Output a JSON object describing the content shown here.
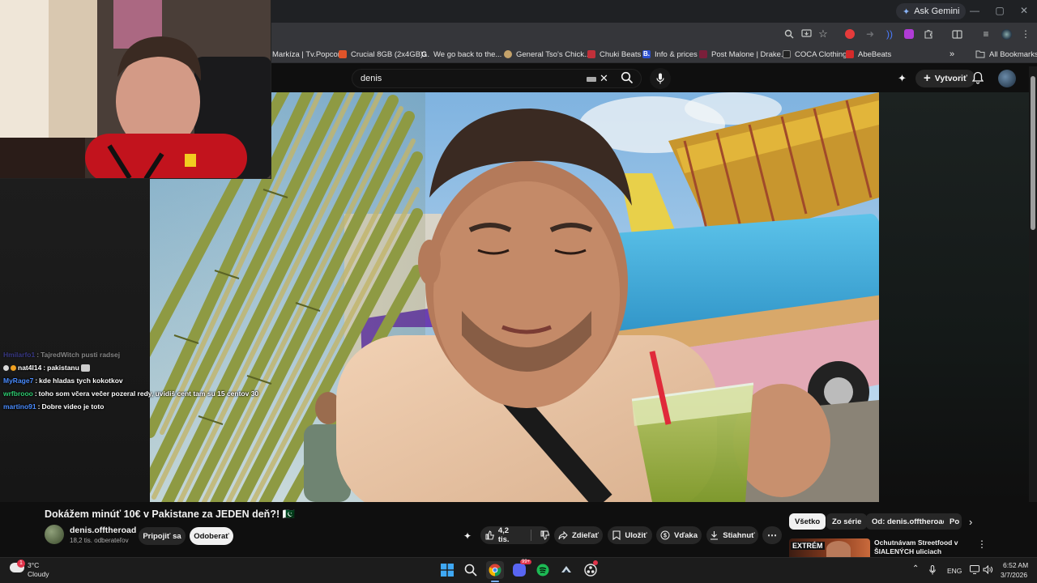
{
  "browser": {
    "gemini_label": "Ask Gemini",
    "bookmarks": [
      {
        "label": "Markíza | Tv.Popcor...",
        "color": "#d9d9d9"
      },
      {
        "label": "Crucial 8GB (2x4GB)...",
        "color": "#e0542a"
      },
      {
        "label": "We go back to the...",
        "color": "#ffffff"
      },
      {
        "label": "General Tso's Chick...",
        "color": "#c4a26a"
      },
      {
        "label": "Chuki Beats",
        "color": "#c0303a"
      },
      {
        "label": "Info & prices",
        "color": "#2a4fd0"
      },
      {
        "label": "Post Malone | Drake...",
        "color": "#7a1f3a"
      },
      {
        "label": "COCA Clothing",
        "color": "#222222"
      },
      {
        "label": "AbeBeats",
        "color": "#d42a2a"
      }
    ],
    "all_bookmarks": "All Bookmarks"
  },
  "youtube": {
    "search_query": "denis",
    "create_label": "Vytvoriť",
    "video_title": "Dokážem minúť 10€ v Pakistane za JEDEN deň?! 🇵🇰",
    "video_flag": "PK",
    "channel_name": "denis.offtheroad",
    "subscribers": "18,2 tis. odberateľov",
    "join_label": "Pripojiť sa",
    "unsubscribe_label": "Odoberať",
    "like_count": "4,2 tis.",
    "share_label": "Zdieľať",
    "save_label": "Uložiť",
    "thanks_label": "Vďaka",
    "download_label": "Stiahnuť",
    "chips": [
      "Všetko",
      "Zo série",
      "Od: denis.offtheroad",
      "Po"
    ],
    "recommended_title": "Ochutnávam Streetfood v ŠIALENÝCH uliciach Pakistan...",
    "recommended_thumb_text": "EXTRÉM"
  },
  "chat": [
    {
      "user": "Hmilarfo1",
      "user_color": "#5a5aff",
      "text": "TajredWitch pusti radsej",
      "faded": true
    },
    {
      "user": "nat4l14",
      "user_color": "#ffffff",
      "text": "pakistanu",
      "badges": true
    },
    {
      "user": "MyRage7",
      "user_color": "#4a8cff",
      "text": "kde hladas tych kokotkov"
    },
    {
      "user": "wrfbrooo",
      "user_color": "#2ecc71",
      "text": "toho som včera večer pozeral redy, uvidiš cent tam su 15 centov 30"
    },
    {
      "user": "martino91",
      "user_color": "#4a8cff",
      "text": "Dobre video je toto"
    }
  ],
  "taskbar": {
    "weather_temp": "3°C",
    "weather_desc": "Cloudy",
    "weather_badge": "1",
    "lang": "ENG",
    "time": "6:52 AM",
    "date": "3/7/2026",
    "discord_badge": "99+"
  }
}
